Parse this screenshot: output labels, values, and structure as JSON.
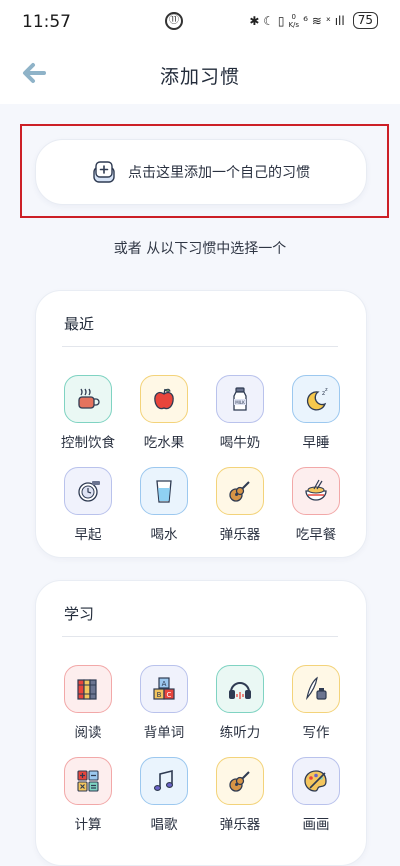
{
  "status_bar": {
    "time": "11:57",
    "center_icon_text": "⑪",
    "right_icons": "✱ ☾ ▯",
    "speed_value": "0",
    "speed_unit": "K/s",
    "signal": "⁶ ≋ ˣ ıll",
    "battery": "75"
  },
  "header": {
    "back_icon": "back-arrow-icon",
    "title": "添加习惯"
  },
  "add_custom": {
    "label": "点击这里添加一个自己的习惯",
    "icon": "add-square-icon"
  },
  "or_text": "或者 从以下习惯中选择一个",
  "sections": [
    {
      "title": "最近",
      "habits": [
        {
          "label": "控制饮食",
          "icon": "coffee-cup-icon",
          "color": "#7fd3c2"
        },
        {
          "label": "吃水果",
          "icon": "apple-icon",
          "color": "#f3d37a"
        },
        {
          "label": "喝牛奶",
          "icon": "milk-bottle-icon",
          "color": "#b9c2ec"
        },
        {
          "label": "早睡",
          "icon": "moon-sleep-icon",
          "color": "#9cc8ef"
        },
        {
          "label": "早起",
          "icon": "alarm-clock-icon",
          "color": "#b9c2ec"
        },
        {
          "label": "喝水",
          "icon": "water-glass-icon",
          "color": "#9cc8ef"
        },
        {
          "label": "弹乐器",
          "icon": "guitar-icon",
          "color": "#f3d37a"
        },
        {
          "label": "吃早餐",
          "icon": "breakfast-bowl-icon",
          "color": "#f2a8a8"
        }
      ]
    },
    {
      "title": "学习",
      "habits": [
        {
          "label": "阅读",
          "icon": "books-icon",
          "color": "#f2a8a8"
        },
        {
          "label": "背单词",
          "icon": "abc-blocks-icon",
          "color": "#b9c2ec"
        },
        {
          "label": "练听力",
          "icon": "headphones-icon",
          "color": "#7fd3c2"
        },
        {
          "label": "写作",
          "icon": "quill-ink-icon",
          "color": "#f3d37a"
        },
        {
          "label": "计算",
          "icon": "calculator-icon",
          "color": "#f2a8a8"
        },
        {
          "label": "唱歌",
          "icon": "music-note-icon",
          "color": "#9cc8ef"
        },
        {
          "label": "弹乐器",
          "icon": "guitar-icon",
          "color": "#f3d37a"
        },
        {
          "label": "画画",
          "icon": "paint-palette-icon",
          "color": "#b9c2ec"
        }
      ]
    }
  ],
  "colors": {
    "highlight_frame": "#cc1f26",
    "back_arrow": "#8fb3c8",
    "background": "#f5f7fc"
  }
}
